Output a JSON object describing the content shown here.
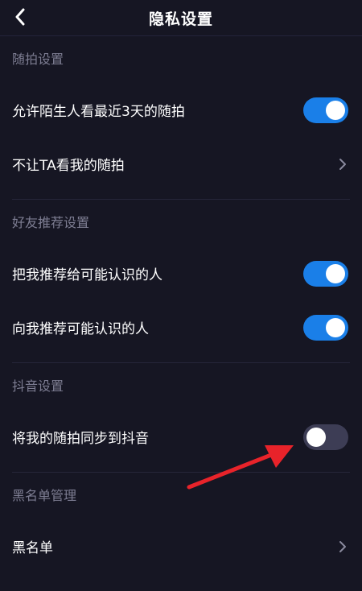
{
  "header": {
    "title": "隐私设置",
    "back_icon": "chevron-left-icon"
  },
  "sections": [
    {
      "title": "随拍设置",
      "items": [
        {
          "label": "允许陌生人看最近3天的随拍",
          "control": "toggle",
          "on": true
        },
        {
          "label": "不让TA看我的随拍",
          "control": "chevron"
        }
      ]
    },
    {
      "title": "好友推荐设置",
      "items": [
        {
          "label": "把我推荐给可能认识的人",
          "control": "toggle",
          "on": true
        },
        {
          "label": "向我推荐可能认识的人",
          "control": "toggle",
          "on": true
        }
      ]
    },
    {
      "title": "抖音设置",
      "items": [
        {
          "label": "将我的随拍同步到抖音",
          "control": "toggle",
          "on": false
        }
      ]
    },
    {
      "title": "黑名单管理",
      "items": [
        {
          "label": "黑名单",
          "control": "chevron"
        }
      ]
    }
  ],
  "colors": {
    "background": "#161623",
    "toggle_on": "#1a7fe8",
    "toggle_off": "#3d3d55",
    "section_title": "#7d7d92",
    "annotation_arrow": "#e8232a"
  }
}
